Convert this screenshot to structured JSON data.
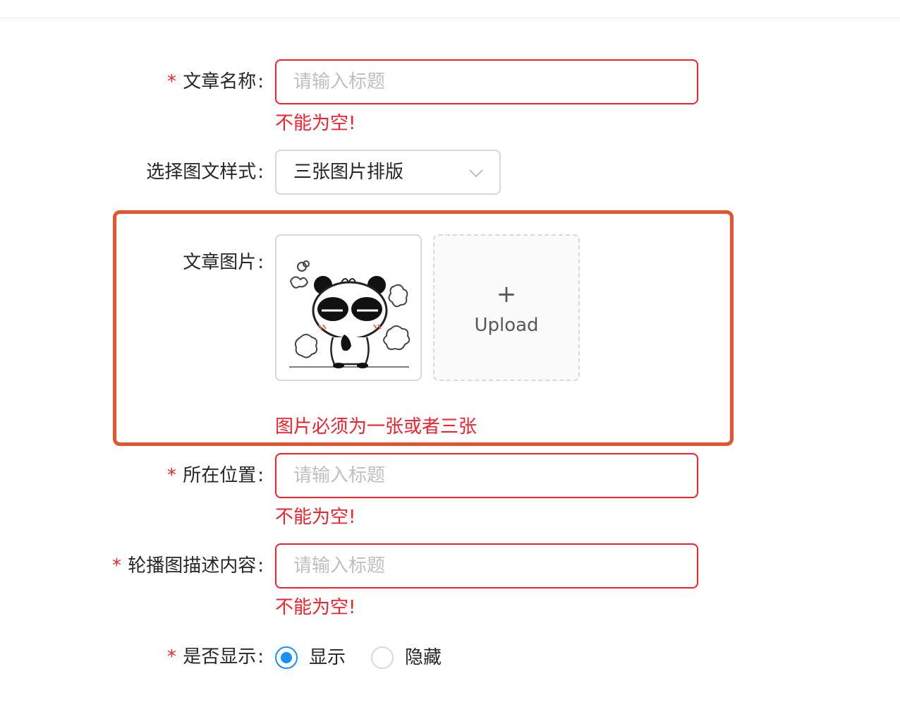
{
  "form": {
    "title_field": {
      "label": "文章名称",
      "required": true,
      "placeholder": "请输入标题",
      "value": "",
      "error": "不能为空!"
    },
    "style_field": {
      "label": "选择图文样式",
      "selected": "三张图片排版"
    },
    "image_field": {
      "label": "文章图片",
      "upload_label": "Upload",
      "upload_plus": "+",
      "error": "图片必须为一张或者三张"
    },
    "location_field": {
      "label": "所在位置",
      "required": true,
      "placeholder": "请输入标题",
      "value": "",
      "error": "不能为空!"
    },
    "carousel_field": {
      "label": "轮播图描述内容",
      "required": true,
      "placeholder": "请输入标题",
      "value": "",
      "error": "不能为空!"
    },
    "display_field": {
      "label": "是否显示",
      "required": true,
      "options": [
        {
          "label": "显示",
          "checked": true
        },
        {
          "label": "隐藏",
          "checked": false
        }
      ]
    }
  },
  "symbols": {
    "required_mark": "*",
    "colon": ":"
  },
  "colors": {
    "error": "#f5222d",
    "highlight_border": "#e8532f",
    "radio_active": "#1890ff",
    "border_default": "#d9d9d9",
    "placeholder": "#bfbfbf"
  },
  "icons": {
    "select_arrow": "chevron-down-icon",
    "upload": "plus-icon",
    "thumbnail": "panda-sticker-image"
  }
}
